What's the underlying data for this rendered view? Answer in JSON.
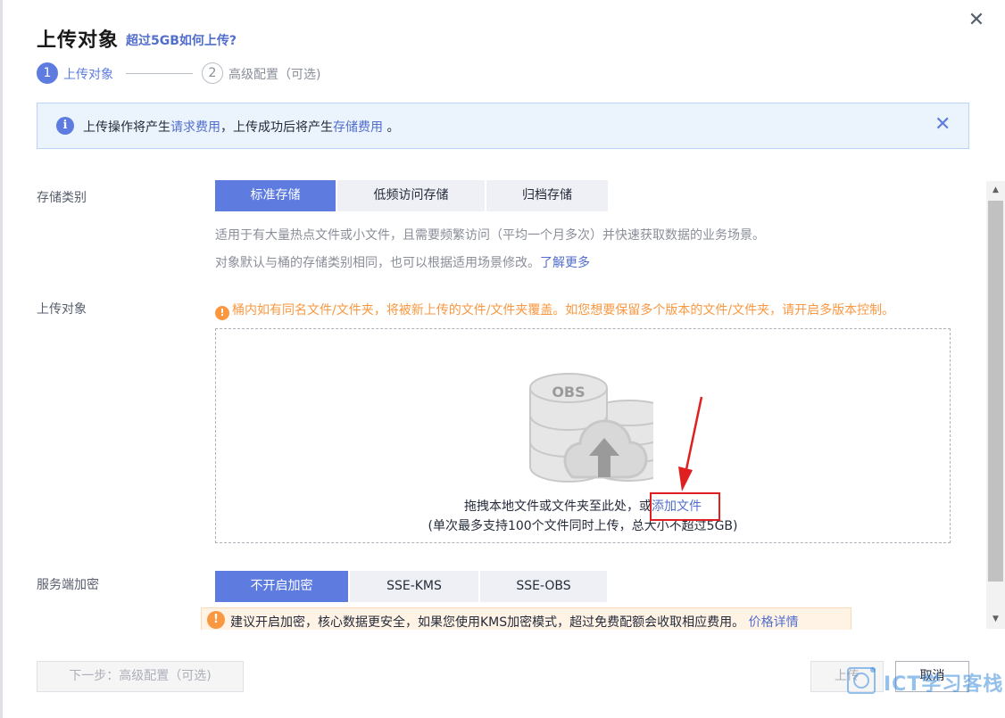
{
  "dialog": {
    "title": "上传对象",
    "title_link": "超过5GB如何上传?",
    "close_icon": "close-icon"
  },
  "steps": [
    {
      "number": "1",
      "label": "上传对象",
      "active": true
    },
    {
      "number": "2",
      "label": "高级配置（可选)",
      "active": false
    }
  ],
  "banner": {
    "icon": "info-icon",
    "text_1": "上传操作将产生",
    "link_1": "请求费用",
    "text_2": "，上传成功后将产生",
    "link_2": "存储费用",
    "text_3": "。",
    "close_icon": "close-icon"
  },
  "storage_class": {
    "label": "存储类别",
    "options": [
      "标准存储",
      "低频访问存储",
      "归档存储"
    ],
    "selected": "标准存储",
    "desc_1": "适用于有大量热点文件或小文件，且需要频繁访问（平均一个月多次）并快速获取数据的业务场景。",
    "desc_2": "对象默认与桶的存储类别相同，也可以根据适用场景修改。",
    "desc_link": "了解更多"
  },
  "upload_object": {
    "label": "上传对象",
    "warning": "桶内如有同名文件/文件夹，将被新上传的文件/文件夹覆盖。如您想要保留多个版本的文件/文件夹，请开启多版本控制。",
    "illustration_label": "OBS",
    "drop_text": "拖拽本地文件或文件夹至此处，或",
    "add_file_link": "添加文件",
    "drop_sub": "(单次最多支持100个文件同时上传，总大小不超过5GB)"
  },
  "encryption": {
    "label": "服务端加密",
    "options": [
      "不开启加密",
      "SSE-KMS",
      "SSE-OBS"
    ],
    "selected": "不开启加密",
    "warning_text": "建议开启加密，核心数据更安全，如果您使用KMS加密模式，超过免费配额会收取相应费用。",
    "warning_link": "价格详情"
  },
  "footer": {
    "next_button": "下一步：高级配置（可选)",
    "upload_button": "上传",
    "cancel_button": "取消"
  },
  "watermark": {
    "text": "ICT学习客栈"
  },
  "colors": {
    "primary": "#5e7ce0",
    "link": "#526ecc",
    "warning": "#fa9841",
    "annotation_red": "#e02020"
  }
}
